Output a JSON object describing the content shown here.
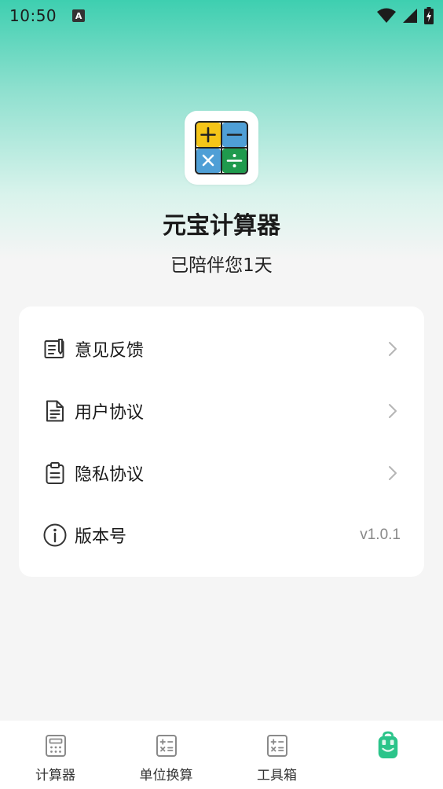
{
  "status": {
    "time": "10:50",
    "notif_letter": "A"
  },
  "app": {
    "name": "元宝计算器",
    "days_text": "已陪伴您1天"
  },
  "menu": [
    {
      "label": "意见反馈",
      "icon": "feedback-icon"
    },
    {
      "label": "用户协议",
      "icon": "document-icon"
    },
    {
      "label": "隐私协议",
      "icon": "clipboard-icon"
    },
    {
      "label": "版本号",
      "icon": "info-icon",
      "value": "v1.0.1"
    }
  ],
  "tabs": [
    {
      "label": "计算器",
      "icon": "calculator-icon"
    },
    {
      "label": "单位换算",
      "icon": "conversion-icon"
    },
    {
      "label": "工具箱",
      "icon": "toolbox-icon"
    },
    {
      "label": "",
      "icon": "mine-icon",
      "active": true
    }
  ],
  "colors": {
    "accent": "#2bc48a",
    "header_gradient_top": "#3ecfb0"
  }
}
